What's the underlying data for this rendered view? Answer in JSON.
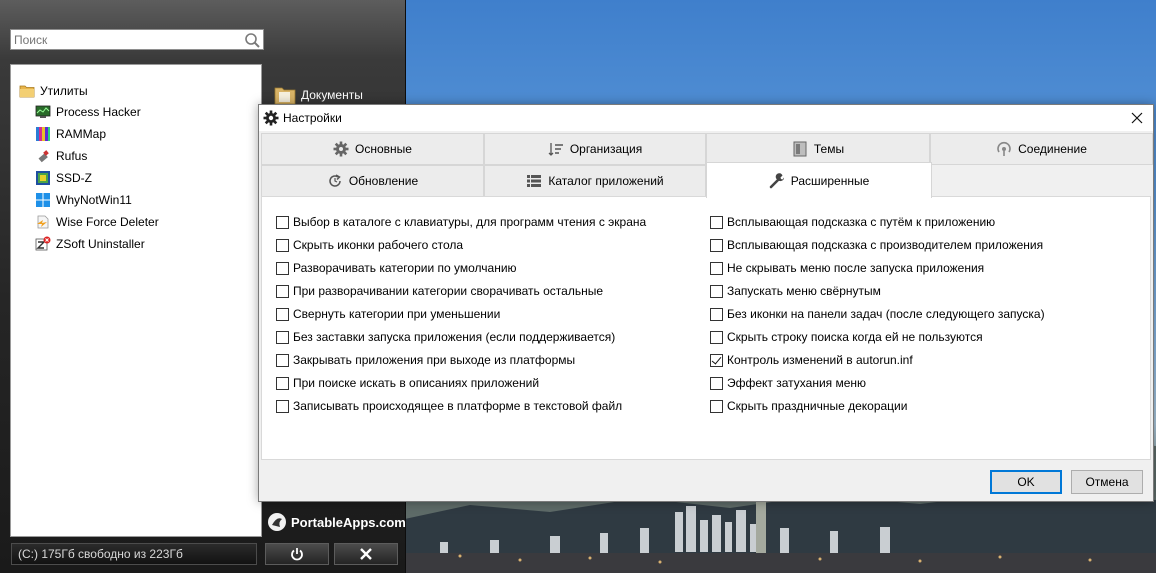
{
  "menu": {
    "search": {
      "placeholder": "Поиск"
    },
    "category": "Утилиты",
    "apps": [
      "Process Hacker",
      "RAMMap",
      "Rufus",
      "SSD-Z",
      "WhyNotWin11",
      "Wise Force Deleter",
      "ZSoft Uninstaller"
    ],
    "documents_label": "Документы",
    "brand": "PortableApps.com",
    "drive_status": "(C:) 175Гб свободно из 223Гб"
  },
  "dialog": {
    "title": "Настройки",
    "tabs_row1": [
      "Основные",
      "Организация",
      "Темы",
      "Соединение"
    ],
    "tabs_row2": [
      "Обновление",
      "Каталог приложений",
      "Расширенные"
    ],
    "active_tab": "Расширенные",
    "left_options": [
      {
        "label": "Выбор в каталоге с клавиатуры, для программ чтения с экрана",
        "checked": false
      },
      {
        "label": "Скрыть иконки рабочего стола",
        "checked": false
      },
      {
        "label": "Разворачивать категории по умолчанию",
        "checked": false
      },
      {
        "label": "При разворачивании категории сворачивать остальные",
        "checked": false
      },
      {
        "label": "Свернуть категории при уменьшении",
        "checked": false
      },
      {
        "label": "Без заставки запуска приложения (если поддерживается)",
        "checked": false
      },
      {
        "label": "Закрывать приложения при выходе из платформы",
        "checked": false
      },
      {
        "label": "При поиске искать в описаниях приложений",
        "checked": false
      },
      {
        "label": "Записывать происходящее в платформе в текстовой файл",
        "checked": false
      }
    ],
    "right_options": [
      {
        "label": "Всплывающая подсказка с путём к приложению",
        "checked": false
      },
      {
        "label": "Всплывающая подсказка с производителем приложения",
        "checked": false
      },
      {
        "label": "Не скрывать меню после запуска приложения",
        "checked": false
      },
      {
        "label": "Запускать меню свёрнутым",
        "checked": false
      },
      {
        "label": "Без иконки на панели задач (после следующего запуска)",
        "checked": false
      },
      {
        "label": "Скрыть строку поиска когда ей не пользуются",
        "checked": false
      },
      {
        "label": "Контроль изменений в autorun.inf",
        "checked": true
      },
      {
        "label": "Эффект затухания меню",
        "checked": false
      },
      {
        "label": "Скрыть праздничные декорации",
        "checked": false
      }
    ],
    "ok_label": "OK",
    "cancel_label": "Отмена"
  }
}
